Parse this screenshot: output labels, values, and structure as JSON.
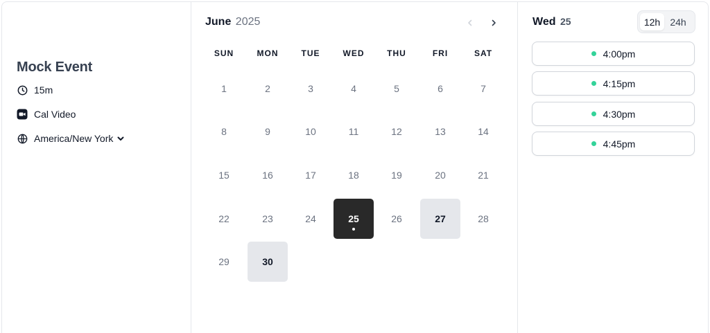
{
  "event": {
    "title": "Mock Event",
    "duration": "15m",
    "location": "Cal Video",
    "timezone": "America/New York",
    "icons": {
      "duration": "clock-icon",
      "location": "video-icon",
      "timezone": "globe-icon",
      "timezone_toggle": "chevron-down-icon"
    }
  },
  "calendar": {
    "month": "June",
    "year": "2025",
    "weekdays": [
      "SUN",
      "MON",
      "TUE",
      "WED",
      "THU",
      "FRI",
      "SAT"
    ],
    "days": [
      {
        "label": "1",
        "state": "disabled"
      },
      {
        "label": "2",
        "state": "disabled"
      },
      {
        "label": "3",
        "state": "disabled"
      },
      {
        "label": "4",
        "state": "disabled"
      },
      {
        "label": "5",
        "state": "disabled"
      },
      {
        "label": "6",
        "state": "disabled"
      },
      {
        "label": "7",
        "state": "disabled"
      },
      {
        "label": "8",
        "state": "disabled"
      },
      {
        "label": "9",
        "state": "disabled"
      },
      {
        "label": "10",
        "state": "disabled"
      },
      {
        "label": "11",
        "state": "disabled"
      },
      {
        "label": "12",
        "state": "disabled"
      },
      {
        "label": "13",
        "state": "disabled"
      },
      {
        "label": "14",
        "state": "disabled"
      },
      {
        "label": "15",
        "state": "disabled"
      },
      {
        "label": "16",
        "state": "disabled"
      },
      {
        "label": "17",
        "state": "disabled"
      },
      {
        "label": "18",
        "state": "disabled"
      },
      {
        "label": "19",
        "state": "disabled"
      },
      {
        "label": "20",
        "state": "disabled"
      },
      {
        "label": "21",
        "state": "disabled"
      },
      {
        "label": "22",
        "state": "disabled"
      },
      {
        "label": "23",
        "state": "disabled"
      },
      {
        "label": "24",
        "state": "disabled"
      },
      {
        "label": "25",
        "state": "selected"
      },
      {
        "label": "26",
        "state": "disabled"
      },
      {
        "label": "27",
        "state": "available"
      },
      {
        "label": "28",
        "state": "disabled"
      },
      {
        "label": "29",
        "state": "disabled"
      },
      {
        "label": "30",
        "state": "available"
      }
    ],
    "colors": {
      "selected": "#292929",
      "available": "#e5e7eb"
    }
  },
  "slots": {
    "selected_weekday": "Wed",
    "selected_day": "25",
    "format_options": [
      "12h",
      "24h"
    ],
    "active_format": "12h",
    "times": [
      "4:00pm",
      "4:15pm",
      "4:30pm",
      "4:45pm"
    ],
    "dot_color": "#34d399"
  }
}
